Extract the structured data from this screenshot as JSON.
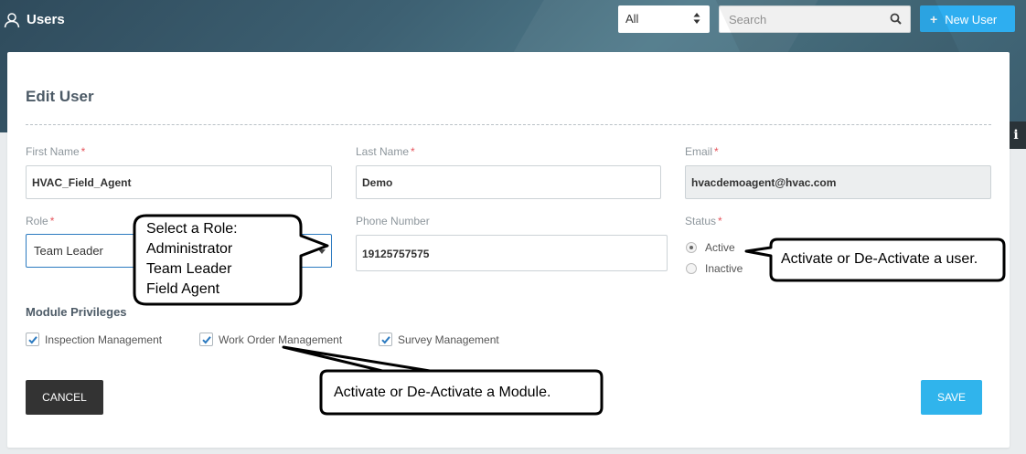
{
  "header": {
    "title": "Users",
    "filter_value": "All",
    "search_placeholder": "Search",
    "new_user_label": "New User",
    "plus_glyph": "+",
    "info_glyph": "i"
  },
  "form": {
    "title": "Edit User",
    "first_name": {
      "label": "First Name",
      "required_mark": "*",
      "value": "HVAC_Field_Agent"
    },
    "last_name": {
      "label": "Last Name",
      "required_mark": "*",
      "value": "Demo"
    },
    "email": {
      "label": "Email",
      "required_mark": "*",
      "value": "hvacdemoagent@hvac.com"
    },
    "role": {
      "label": "Role",
      "required_mark": "*",
      "value": "Team Leader"
    },
    "phone": {
      "label": "Phone Number",
      "value": "19125757575"
    },
    "status": {
      "label": "Status",
      "required_mark": "*",
      "options": [
        {
          "label": "Active",
          "selected": true
        },
        {
          "label": "Inactive",
          "selected": false
        }
      ]
    },
    "modules": {
      "heading": "Module Privileges",
      "items": [
        {
          "label": "Inspection Management",
          "checked": true
        },
        {
          "label": "Work Order Management",
          "checked": true
        },
        {
          "label": "Survey Management",
          "checked": true
        }
      ]
    },
    "cancel_label": "CANCEL",
    "save_label": "SAVE"
  },
  "annotations": {
    "role_callout": [
      "Select a Role:",
      "Administrator",
      "Team Leader",
      "Field Agent"
    ],
    "status_callout": "Activate or De-Activate a user.",
    "module_callout": "Activate or De-Activate a Module."
  },
  "colors": {
    "accent": "#2eaef0",
    "save": "#30b4ec",
    "cancel": "#333333",
    "required": "#e6545c",
    "check": "#2b7ac0"
  }
}
